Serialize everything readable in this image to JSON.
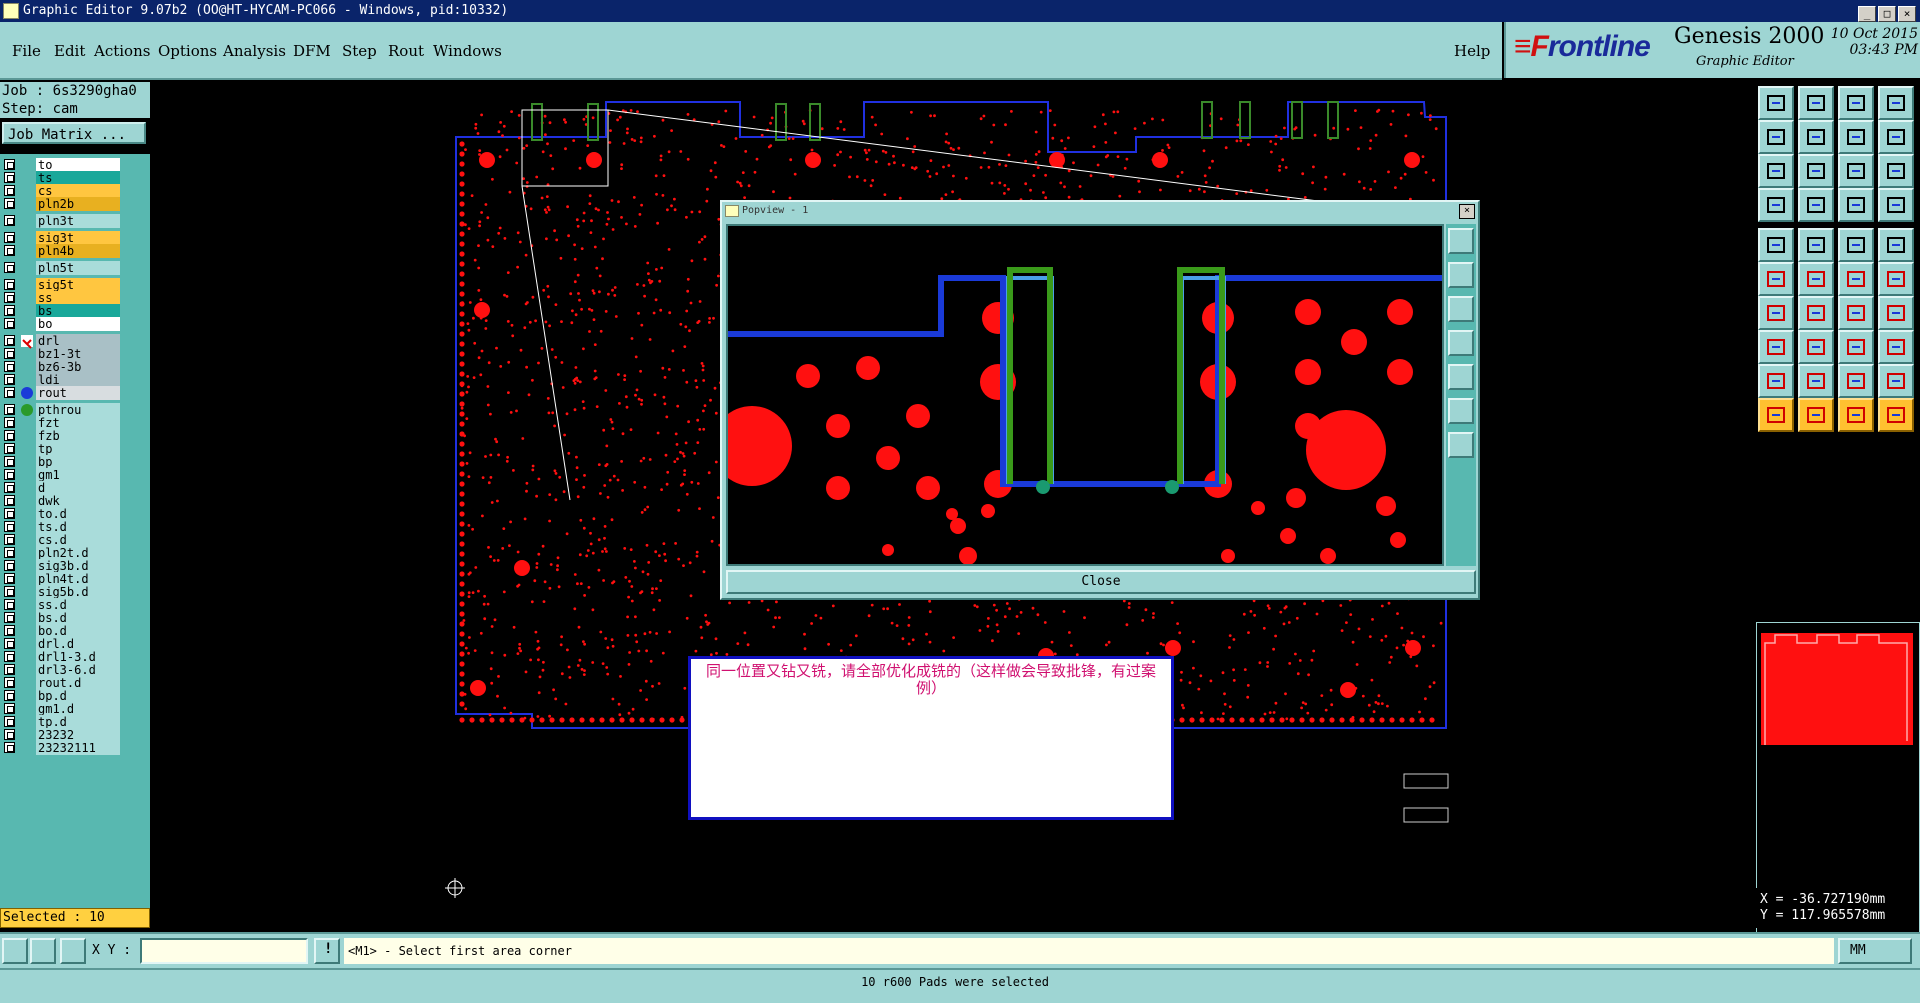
{
  "window": {
    "title": "Graphic Editor 9.07b2 (OO@HT-HYCAM-PC066 - Windows, pid:10332)"
  },
  "menu": [
    "File",
    "Edit",
    "Actions",
    "Options",
    "Analysis",
    "DFM",
    "Step",
    "Rout",
    "Windows"
  ],
  "help_label": "Help",
  "brand": {
    "logo_a": "≡F",
    "logo_b": "rontline",
    "product": "Genesis 2000",
    "subtitle": "Graphic Editor",
    "date": "10 Oct 2015",
    "time": "03:43 PM"
  },
  "job": {
    "job_line": "Job : 6s3290gha0",
    "step_line": "Step: cam",
    "matrix_button": "Job Matrix ..."
  },
  "layers": [
    {
      "name": "to",
      "color": "#ffffff",
      "group": 0
    },
    {
      "name": "ts",
      "color": "#1aa89a",
      "group": 0
    },
    {
      "name": "cs",
      "color": "#ffc640",
      "group": 0
    },
    {
      "name": "pln2b",
      "color": "#e8b020",
      "group": 0
    },
    {
      "name": "pln3t",
      "color": "#a9dcda",
      "group": 1
    },
    {
      "name": "sig3t",
      "color": "#ffc640",
      "group": 2
    },
    {
      "name": "pln4b",
      "color": "#e8b020",
      "group": 2
    },
    {
      "name": "pln5t",
      "color": "#a9dcda",
      "group": 3
    },
    {
      "name": "sig5t",
      "color": "#ffc640",
      "group": 4
    },
    {
      "name": "ss",
      "color": "#ffc640",
      "group": 4
    },
    {
      "name": "bs",
      "color": "#1aa89a",
      "group": 4
    },
    {
      "name": "bo",
      "color": "#ffffff",
      "group": 4
    },
    {
      "name": "drl",
      "color": "#a9c0c6",
      "group": 5,
      "mark": "tool"
    },
    {
      "name": "bz1-3t",
      "color": "#a9c0c6",
      "group": 5
    },
    {
      "name": "bz6-3b",
      "color": "#a9c0c6",
      "group": 5
    },
    {
      "name": "ldi",
      "color": "#a9c0c6",
      "group": 5
    },
    {
      "name": "rout",
      "color": "#d8dde0",
      "group": 5,
      "mark": "#1a3ad8"
    },
    {
      "name": "pthrou",
      "color": "#a9dcda",
      "group": 6,
      "mark": "#2a9a2a"
    },
    {
      "name": "fzt",
      "color": "#a9dcda",
      "group": 6
    },
    {
      "name": "fzb",
      "color": "#a9dcda",
      "group": 6
    },
    {
      "name": "tp",
      "color": "#a9dcda",
      "group": 6
    },
    {
      "name": "bp",
      "color": "#a9dcda",
      "group": 6
    },
    {
      "name": "gm1",
      "color": "#a9dcda",
      "group": 6
    },
    {
      "name": "d",
      "color": "#a9dcda",
      "group": 6
    },
    {
      "name": "dwk",
      "color": "#a9dcda",
      "group": 6
    },
    {
      "name": "to.d",
      "color": "#a9dcda",
      "group": 6
    },
    {
      "name": "ts.d",
      "color": "#a9dcda",
      "group": 6
    },
    {
      "name": "cs.d",
      "color": "#a9dcda",
      "group": 6
    },
    {
      "name": "pln2t.d",
      "color": "#a9dcda",
      "group": 6
    },
    {
      "name": "sig3b.d",
      "color": "#a9dcda",
      "group": 6
    },
    {
      "name": "pln4t.d",
      "color": "#a9dcda",
      "group": 6
    },
    {
      "name": "sig5b.d",
      "color": "#a9dcda",
      "group": 6
    },
    {
      "name": "ss.d",
      "color": "#a9dcda",
      "group": 6
    },
    {
      "name": "bs.d",
      "color": "#a9dcda",
      "group": 6
    },
    {
      "name": "bo.d",
      "color": "#a9dcda",
      "group": 6
    },
    {
      "name": "drl.d",
      "color": "#a9dcda",
      "group": 6
    },
    {
      "name": "drl1-3.d",
      "color": "#a9dcda",
      "group": 6
    },
    {
      "name": "drl3-6.d",
      "color": "#a9dcda",
      "group": 6
    },
    {
      "name": "rout.d",
      "color": "#a9dcda",
      "group": 6
    },
    {
      "name": "bp.d",
      "color": "#a9dcda",
      "group": 6
    },
    {
      "name": "gm1.d",
      "color": "#a9dcda",
      "group": 6
    },
    {
      "name": "tp.d",
      "color": "#a9dcda",
      "group": 6
    },
    {
      "name": "23232",
      "color": "#a9dcda",
      "group": 6
    },
    {
      "name": "23232111",
      "color": "#a9dcda",
      "group": 6
    }
  ],
  "selected_label": "Selected : 10",
  "popview": {
    "title": "Popview - 1",
    "close_label": "Close"
  },
  "note": "同一位置又钻又铣，请全部优化成铣的（这样做会导致批锋，有过案例）",
  "coords": {
    "x": "X  = -36.727190mm",
    "y": "Y  = 117.965578mm"
  },
  "cmd": {
    "xy_label": "X Y :",
    "prompt": "<M1> - Select first area corner",
    "units": "MM"
  },
  "status": "10 r600 Pads were selected",
  "colors": {
    "panel": "#9ed5d3",
    "copper": "#ff0000",
    "rout": "#1a3ad8",
    "highlight": "#ffc030"
  }
}
